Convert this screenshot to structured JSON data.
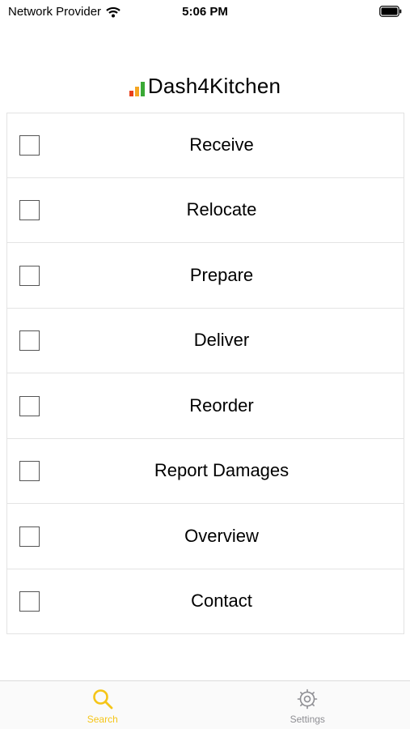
{
  "status_bar": {
    "carrier": "Network Provider",
    "time": "5:06 PM",
    "wifi_icon": "wifi-icon",
    "battery_icon": "battery-icon"
  },
  "header": {
    "logo_text": "Dash4Kitchen",
    "logo_icon": "bar-chart-logo-icon",
    "logo_colors": [
      "#e8401c",
      "#f5a623",
      "#3aa935"
    ]
  },
  "menu": {
    "items": [
      {
        "label": "Receive",
        "checked": false
      },
      {
        "label": "Relocate",
        "checked": false
      },
      {
        "label": "Prepare",
        "checked": false
      },
      {
        "label": "Deliver",
        "checked": false
      },
      {
        "label": "Reorder",
        "checked": false
      },
      {
        "label": "Report Damages",
        "checked": false
      },
      {
        "label": "Overview",
        "checked": false
      },
      {
        "label": "Contact",
        "checked": false
      }
    ]
  },
  "tab_bar": {
    "tabs": [
      {
        "label": "Search",
        "icon": "search-icon",
        "active": true,
        "color": "#f5c518"
      },
      {
        "label": "Settings",
        "icon": "gear-icon",
        "active": false,
        "color": "#8e8e93"
      }
    ]
  }
}
